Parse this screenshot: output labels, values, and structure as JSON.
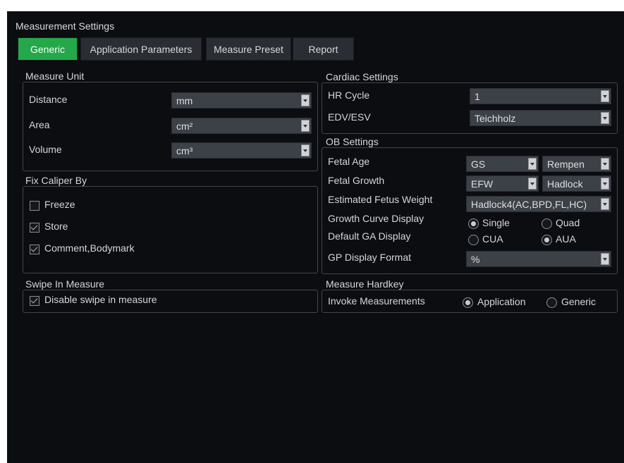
{
  "title": "Measurement Settings",
  "tabs": [
    {
      "label": "Generic",
      "active": true
    },
    {
      "label": "Application Parameters",
      "active": false
    },
    {
      "label": "Measure Preset",
      "active": false
    },
    {
      "label": "Report",
      "active": false
    }
  ],
  "measure_unit": {
    "legend": "Measure Unit",
    "distance": {
      "label": "Distance",
      "value": "mm"
    },
    "area": {
      "label": "Area",
      "value": "cm²"
    },
    "volume": {
      "label": "Volume",
      "value": "cm³"
    }
  },
  "fix_caliper": {
    "legend": "Fix Caliper By",
    "freeze": {
      "label": "Freeze",
      "checked": false
    },
    "store": {
      "label": "Store",
      "checked": true
    },
    "comment": {
      "label": "Comment,Bodymark",
      "checked": true
    }
  },
  "swipe": {
    "legend": "Swipe In Measure",
    "disable": {
      "label": "Disable swipe in measure",
      "checked": true
    }
  },
  "cardiac": {
    "legend": "Cardiac Settings",
    "hr_cycle": {
      "label": "HR Cycle",
      "value": "1"
    },
    "edv_esv": {
      "label": "EDV/ESV",
      "value": "Teichholz"
    }
  },
  "ob": {
    "legend": "OB Settings",
    "fetal_age": {
      "label": "Fetal Age",
      "value": "GS",
      "method": "Rempen"
    },
    "fetal_growth": {
      "label": "Fetal Growth",
      "value": "EFW",
      "method": "Hadlock"
    },
    "efw": {
      "label": "Estimated Fetus Weight",
      "value": "Hadlock4(AC,BPD,FL,HC)"
    },
    "growth_curve": {
      "label": "Growth Curve Display",
      "opt1": "Single",
      "opt2": "Quad",
      "selected": "Single"
    },
    "default_ga": {
      "label": "Default GA Display",
      "opt1": "CUA",
      "opt2": "AUA",
      "selected": "AUA"
    },
    "gp_format": {
      "label": "GP Display Format",
      "value": "%"
    }
  },
  "hardkey": {
    "legend": "Measure Hardkey",
    "invoke": {
      "label": "Invoke Measurements",
      "opt1": "Application",
      "opt2": "Generic",
      "selected": "Application"
    }
  },
  "colors": {
    "active_tab": "#25a84a",
    "background": "#0c0d10",
    "field": "#3c4047"
  }
}
